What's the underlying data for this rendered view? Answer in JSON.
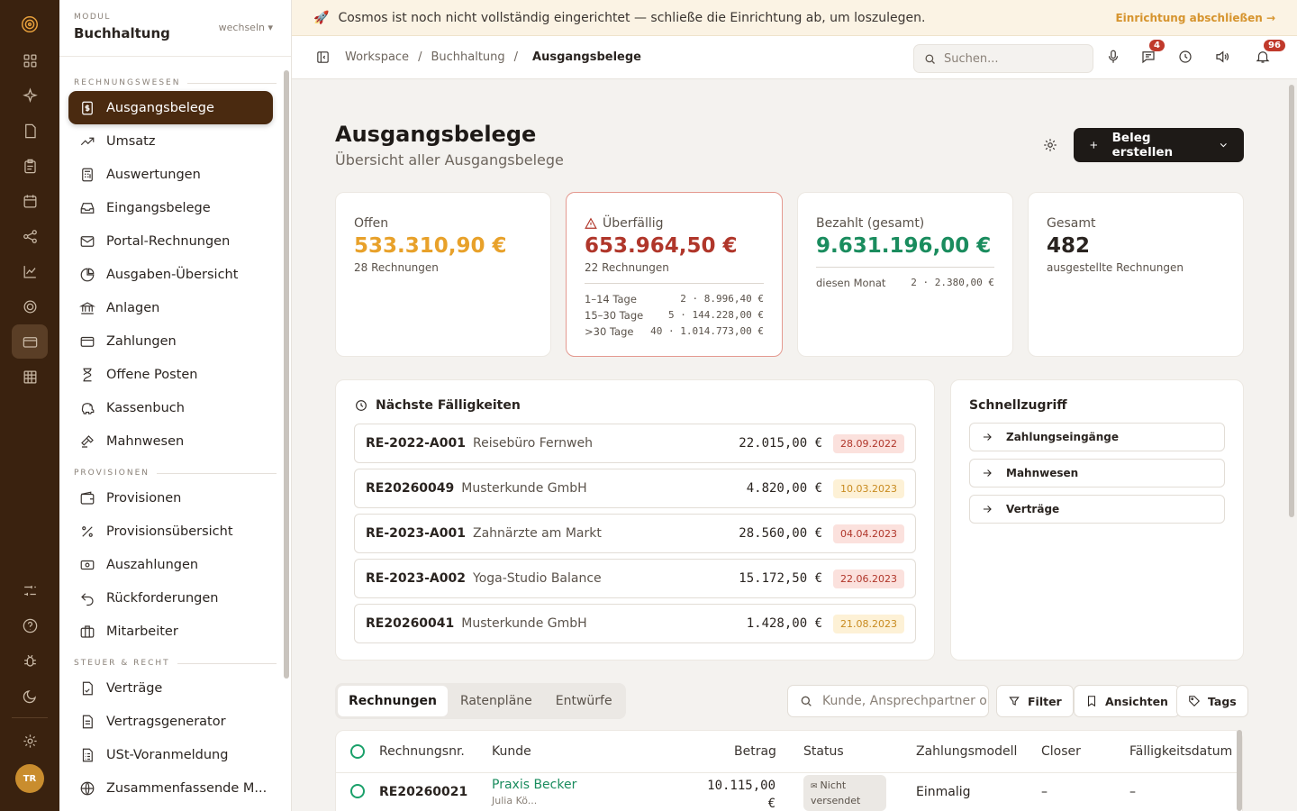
{
  "banner": {
    "text": "Cosmos ist noch nicht vollständig eingerichtet — schließe die Einrichtung ab, um loszulegen.",
    "action": "Einrichtung abschließen →"
  },
  "module": {
    "caption": "MODUL",
    "title": "Buchhaltung",
    "switch": "wechseln ▾"
  },
  "sidebar": {
    "sections": [
      {
        "title": "RECHNUNGSWESEN",
        "items": [
          "Ausgangsbelege",
          "Umsatz",
          "Auswertungen",
          "Eingangsbelege",
          "Portal-Rechnungen",
          "Ausgaben-Übersicht",
          "Anlagen",
          "Zahlungen",
          "Offene Posten",
          "Kassenbuch",
          "Mahnwesen"
        ]
      },
      {
        "title": "PROVISIONEN",
        "items": [
          "Provisionen",
          "Provisionsübersicht",
          "Auszahlungen",
          "Rückforderungen",
          "Mitarbeiter"
        ]
      },
      {
        "title": "STEUER & RECHT",
        "items": [
          "Verträge",
          "Vertragsgenerator",
          "USt-Voranmeldung",
          "Zusammenfassende M..."
        ]
      }
    ],
    "active": "Ausgangsbelege"
  },
  "rail": {
    "avatar": "TR"
  },
  "breadcrumb": {
    "items": [
      "Workspace",
      "Buchhaltung"
    ],
    "current": "Ausgangsbelege",
    "sep": "/"
  },
  "topbar": {
    "search_placeholder": "Suchen...",
    "chat_badge": "4",
    "notif_badge": "96"
  },
  "page": {
    "title": "Ausgangsbelege",
    "subtitle": "Übersicht aller Ausgangsbelege",
    "create_label": "Beleg erstellen"
  },
  "cards": {
    "open": {
      "label": "Offen",
      "value": "533.310,90 €",
      "sub": "28 Rechnungen",
      "color": "#e8a12a"
    },
    "overdue": {
      "label": "Überfällig",
      "value": "653.964,50 €",
      "sub": "22 Rechnungen",
      "color": "#b0362a",
      "rows": [
        {
          "label": "1–14 Tage",
          "value": "2 · 8.996,40 €"
        },
        {
          "label": "15–30 Tage",
          "value": "5 · 144.228,00 €"
        },
        {
          "label": ">30 Tage",
          "value": "40 · 1.014.773,00 €"
        }
      ]
    },
    "paid": {
      "label": "Bezahlt (gesamt)",
      "value": "9.631.196,00 €",
      "color": "#1a8c5e",
      "month_label": "diesen Monat",
      "month_value": "2 · 2.380,00 €"
    },
    "total": {
      "label": "Gesamt",
      "value": "482",
      "sub": "ausgestellte Rechnungen"
    }
  },
  "due": {
    "title": "Nächste Fälligkeiten",
    "items": [
      {
        "id": "RE-2022-A001",
        "customer": "Reisebüro Fernweh",
        "amount": "22.015,00 €",
        "date": "28.09.2022",
        "tone": "red"
      },
      {
        "id": "RE20260049",
        "customer": "Musterkunde GmbH",
        "amount": "4.820,00 €",
        "date": "10.03.2023",
        "tone": "yel"
      },
      {
        "id": "RE-2023-A001",
        "customer": "Zahnärzte am Markt",
        "amount": "28.560,00 €",
        "date": "04.04.2023",
        "tone": "red"
      },
      {
        "id": "RE-2023-A002",
        "customer": "Yoga-Studio Balance",
        "amount": "15.172,50 €",
        "date": "22.06.2023",
        "tone": "red"
      },
      {
        "id": "RE20260041",
        "customer": "Musterkunde GmbH",
        "amount": "1.428,00 €",
        "date": "21.08.2023",
        "tone": "yel"
      }
    ]
  },
  "quick": {
    "title": "Schnellzugriff",
    "items": [
      "Zahlungseingänge",
      "Mahnwesen",
      "Verträge"
    ]
  },
  "tabs": [
    "Rechnungen",
    "Ratenpläne",
    "Entwürfe"
  ],
  "filters": {
    "search_placeholder": "Kunde, Ansprechpartner o",
    "filter": "Filter",
    "views": "Ansichten",
    "tags": "Tags"
  },
  "table": {
    "columns": [
      "Rechnungsnr.",
      "Kunde",
      "Betrag",
      "Status",
      "Zahlungsmodell",
      "Closer",
      "Fälligkeitsdatum"
    ],
    "rows": [
      {
        "nr": "RE20260021",
        "customer": "Praxis Becker",
        "contact": "Julia Kö...",
        "amount": "10.115,00 €",
        "status": "Nicht versendet",
        "model": "Einmalig",
        "closer": "–",
        "due": "–"
      }
    ]
  }
}
